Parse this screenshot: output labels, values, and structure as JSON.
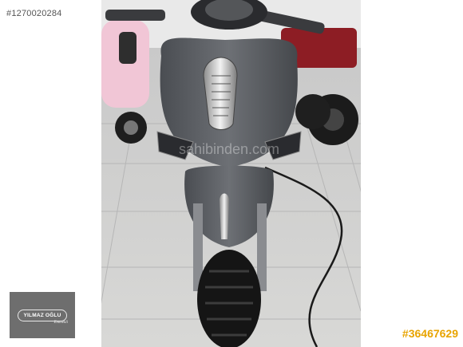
{
  "listing": {
    "id_text": "#1270020284",
    "ad_number": "#36467629"
  },
  "photo": {
    "subject": "scooter",
    "watermark": "sahibinden.com"
  },
  "dealer_logo": {
    "name": "YILMAZ OĞLU",
    "tagline": "Emmekli"
  },
  "colors": {
    "ad_number": "#e8a400",
    "logo_background": "#6e6e6e",
    "scooter_body": "#5e6166"
  }
}
